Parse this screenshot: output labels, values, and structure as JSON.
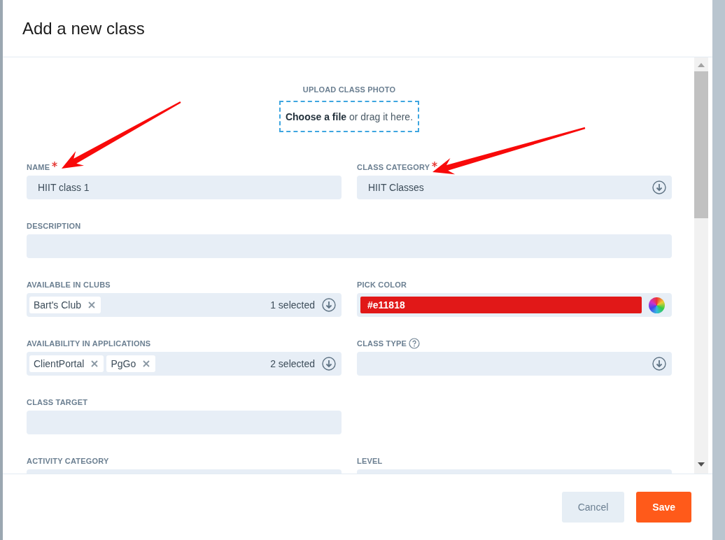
{
  "dialog": {
    "title": "Add a new class"
  },
  "upload": {
    "label": "UPLOAD CLASS PHOTO",
    "action": "Choose a file",
    "hint": "or drag it here."
  },
  "rows": [
    [
      {
        "kind": "text",
        "label": "NAME",
        "required": true,
        "value": "HIIT class 1"
      },
      {
        "kind": "select",
        "label": "CLASS CATEGORY",
        "required": true,
        "value": "HIIT Classes"
      }
    ],
    [
      {
        "kind": "text",
        "label": "DESCRIPTION",
        "required": false,
        "wide": true
      }
    ],
    [
      {
        "kind": "multi",
        "label": "AVAILABLE IN CLUBS",
        "required": false,
        "tags": [
          "Bart's Club"
        ],
        "count": "1 selected"
      },
      {
        "kind": "color",
        "label": "PICK COLOR",
        "required": false,
        "value": "#e11818",
        "color": "#e11818"
      }
    ],
    [
      {
        "kind": "multi",
        "label": "AVAILABILITY IN APPLICATIONS",
        "required": false,
        "tags": [
          "ClientPortal",
          "PgGo"
        ],
        "count": "2 selected"
      },
      {
        "kind": "select",
        "label": "CLASS TYPE",
        "required": false,
        "help": true
      }
    ],
    [
      {
        "kind": "text",
        "label": "CLASS TARGET",
        "required": false
      }
    ],
    [
      {
        "kind": "text",
        "label": "ACTIVITY CATEGORY",
        "required": false
      },
      {
        "kind": "text",
        "label": "LEVEL",
        "required": false
      }
    ]
  ],
  "buttons": [
    {
      "label": "Cancel",
      "kind": "secondary"
    },
    {
      "label": "Save",
      "kind": "primary"
    }
  ]
}
